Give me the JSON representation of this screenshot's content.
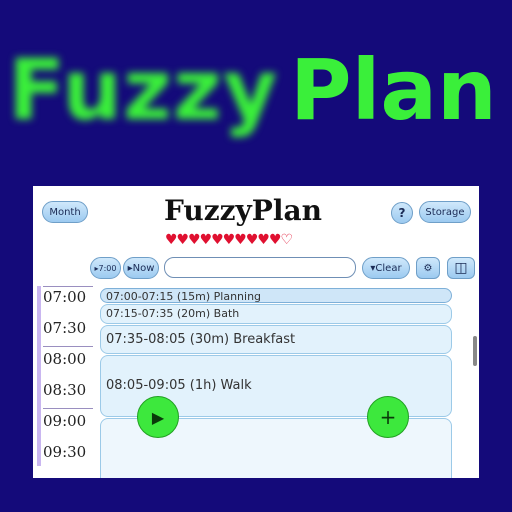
{
  "banner": {
    "left_text": "Fuzzy",
    "right_text": "Plan"
  },
  "app": {
    "title": "FuzzyPlan",
    "hearts": {
      "filled": "♥♥♥♥♥♥♥♥♥♥",
      "empty": "♡"
    },
    "buttons": {
      "month": "Month",
      "help": "?",
      "storage": "Storage",
      "time_700": "▸7:00",
      "now": "▸Now",
      "clear": "▾Clear",
      "settings": "⚙",
      "layout": "◫",
      "play": "▶",
      "add": "+"
    },
    "search": {
      "value": "",
      "placeholder": ""
    },
    "times": [
      "07:00",
      "07:30",
      "08:00",
      "08:30",
      "09:00",
      "09:30"
    ],
    "events": [
      {
        "label": "07:00-07:15 (15m) Planning"
      },
      {
        "label": "07:15-07:35 (20m) Bath"
      },
      {
        "label": "07:35-08:05 (30m) Breakfast"
      },
      {
        "label": "08:05-09:05 (1h) Walk"
      }
    ]
  }
}
